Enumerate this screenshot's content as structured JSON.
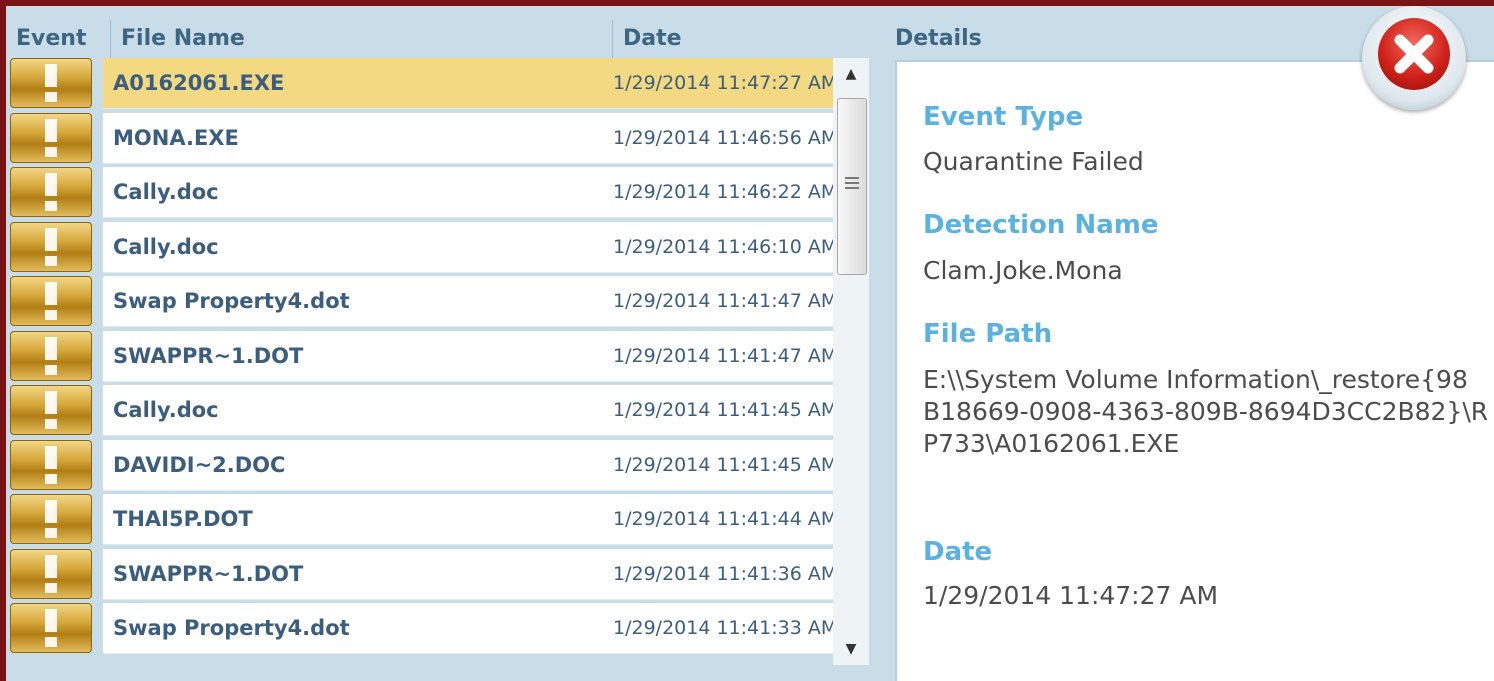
{
  "columns": {
    "event": "Event",
    "file_name": "File Name",
    "date": "Date",
    "details": "Details"
  },
  "rows": [
    {
      "file": "A0162061.EXE",
      "date": "1/29/2014 11:47:27 AM",
      "selected": true
    },
    {
      "file": "MONA.EXE",
      "date": "1/29/2014 11:46:56 AM"
    },
    {
      "file": "Cally.doc",
      "date": "1/29/2014 11:46:22 AM"
    },
    {
      "file": "Cally.doc",
      "date": "1/29/2014 11:46:10 AM"
    },
    {
      "file": "Swap Property4.dot",
      "date": "1/29/2014 11:41:47 AM"
    },
    {
      "file": "SWAPPR~1.DOT",
      "date": "1/29/2014 11:41:47 AM"
    },
    {
      "file": "Cally.doc",
      "date": "1/29/2014 11:41:45 AM"
    },
    {
      "file": "DAVIDI~2.DOC",
      "date": "1/29/2014 11:41:45 AM"
    },
    {
      "file": "THAI5P.DOT",
      "date": "1/29/2014 11:41:44 AM"
    },
    {
      "file": "SWAPPR~1.DOT",
      "date": "1/29/2014 11:41:36 AM"
    },
    {
      "file": "Swap Property4.dot",
      "date": "1/29/2014 11:41:33 AM"
    }
  ],
  "event_icon": "warning-icon",
  "details": {
    "event_type_label": "Event Type",
    "event_type": "Quarantine Failed",
    "detection_name_label": "Detection Name",
    "detection_name": "Clam.Joke.Mona",
    "file_path_label": "File Path",
    "file_path_lines": [
      "E:\\\\System Volume Information\\_restore{98",
      "B18669-0908-4363-809B-8694D3CC2B82}\\R",
      "P733\\A0162061.EXE"
    ],
    "date_label": "Date",
    "date": "1/29/2014 11:47:27 AM"
  },
  "close_icon": "close-icon",
  "colors": {
    "selected_row": "#f2d982",
    "label_blue": "#5bb2df",
    "frame": "#7a1414"
  }
}
